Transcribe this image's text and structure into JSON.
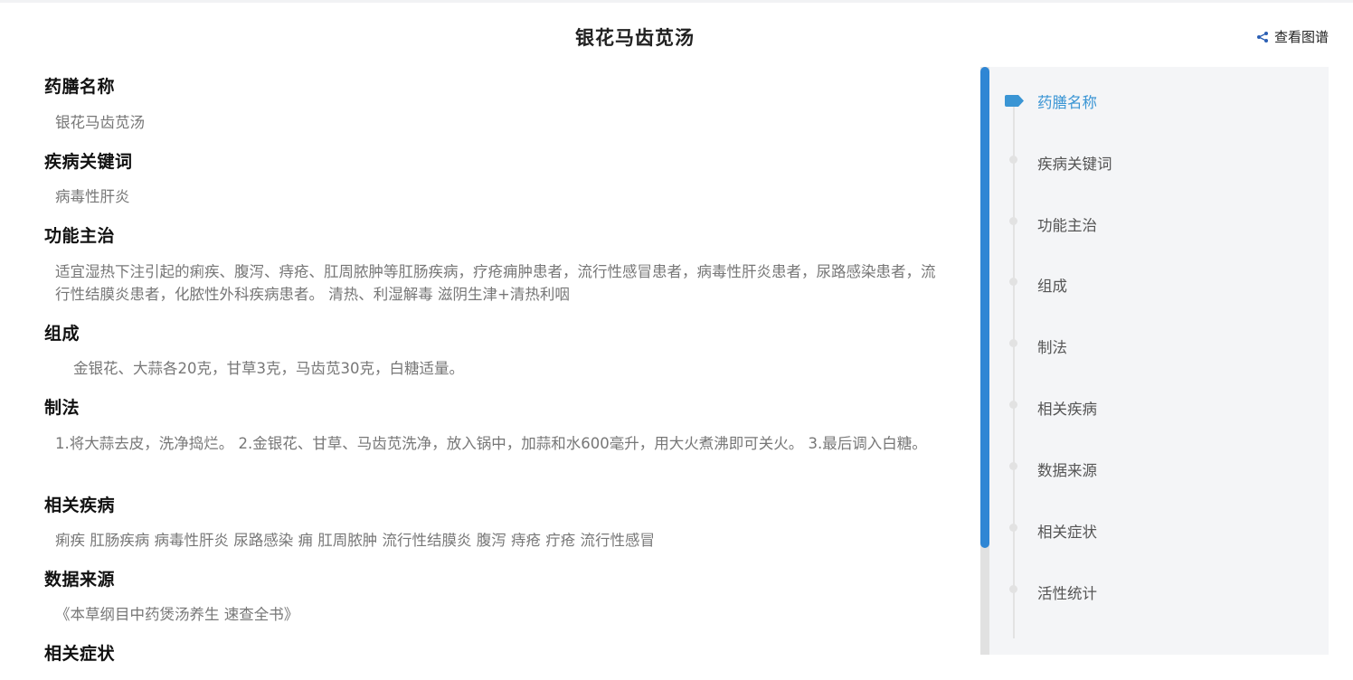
{
  "header": {
    "title": "银花马齿苋汤",
    "graph_link_label": "查看图谱"
  },
  "sections": [
    {
      "title": "药膳名称",
      "body": "银花马齿苋汤"
    },
    {
      "title": "疾病关键词",
      "body": "病毒性肝炎"
    },
    {
      "title": "功能主治",
      "body": "适宜湿热下注引起的痢疾、腹泻、痔疮、肛周脓肿等肛肠疾病，疗疮痈肿患者，流行性感冒患者，病毒性肝炎患者，尿路感染患者，流行性结膜炎患者，化脓性外科疾病患者。 清热、利湿解毒 滋阴生津+清热利咽"
    },
    {
      "title": "组成",
      "body": "金银花、大蒜各20克，甘草3克，马齿苋30克，白糖适量。"
    },
    {
      "title": "制法",
      "body": "1.将大蒜去皮，洗净捣烂。 2.金银花、甘草、马齿苋洗净，放入锅中，加蒜和水600毫升，用大火煮沸即可关火。 3.最后调入白糖。"
    },
    {
      "title": "相关疾病",
      "body": "痢疾 肛肠疾病 病毒性肝炎 尿路感染 痈 肛周脓肿 流行性结膜炎 腹泻 痔疮 疔疮 流行性感冒"
    },
    {
      "title": "数据来源",
      "body": "《本草纲目中药煲汤养生 速查全书》"
    },
    {
      "title": "相关症状",
      "body": ""
    }
  ],
  "toc": {
    "items": [
      {
        "label": "药膳名称",
        "active": true
      },
      {
        "label": "疾病关键词",
        "active": false
      },
      {
        "label": "功能主治",
        "active": false
      },
      {
        "label": "组成",
        "active": false
      },
      {
        "label": "制法",
        "active": false
      },
      {
        "label": "相关疾病",
        "active": false
      },
      {
        "label": "数据来源",
        "active": false
      },
      {
        "label": "相关症状",
        "active": false
      },
      {
        "label": "活性统计",
        "active": false
      }
    ]
  },
  "colors": {
    "accent": "#3a95d4",
    "scroll_thumb": "#2f86d4"
  },
  "icons": {
    "graph_link": "share-icon",
    "active_toc": "tag-icon"
  }
}
